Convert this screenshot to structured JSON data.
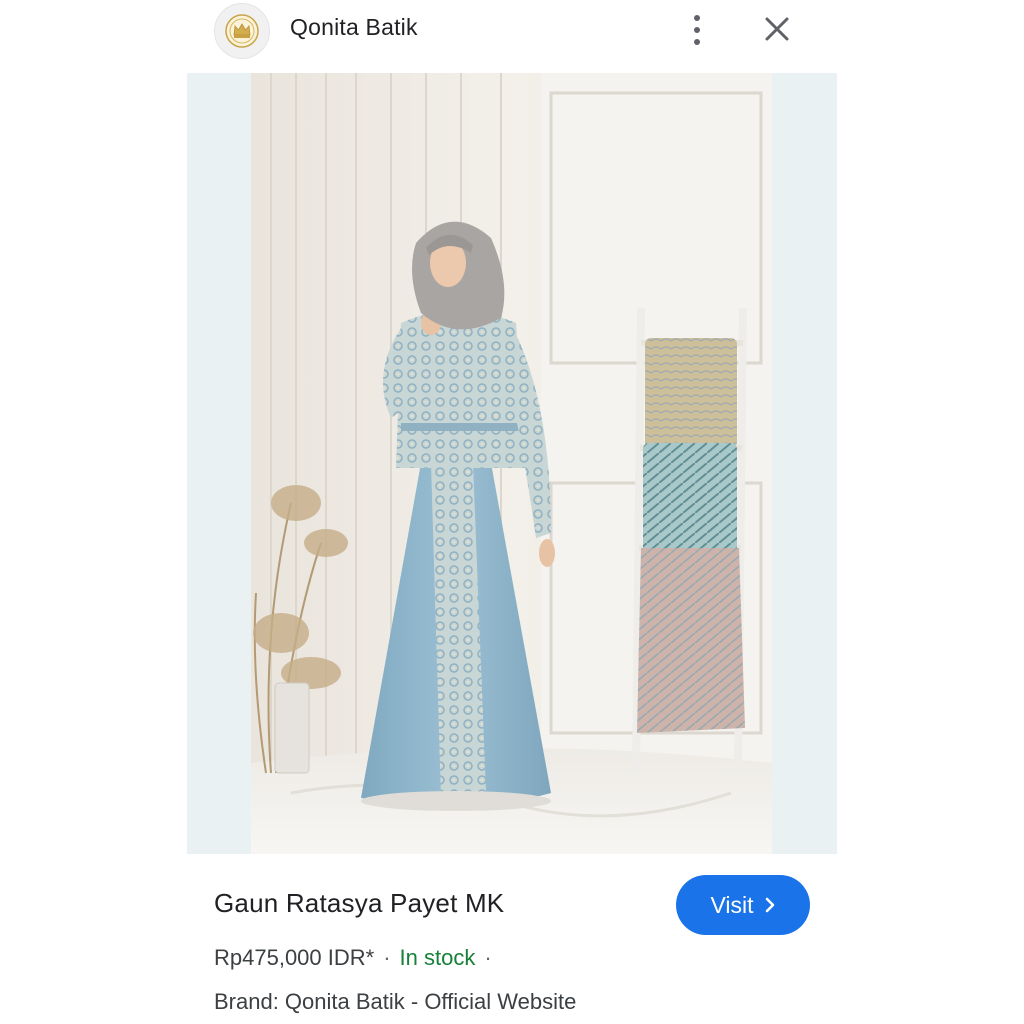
{
  "header": {
    "site_name": "Qonita Batik",
    "logo_icon": "crown-emblem-icon",
    "more_icon": "more-vertical-icon",
    "close_icon": "close-icon"
  },
  "image": {
    "subject": "product-photo"
  },
  "product": {
    "title": "Gaun Ratasya Payet MK",
    "price": "Rp475,000 IDR*",
    "separator": "·",
    "stock_status": "In stock",
    "brand_line": "Brand: Qonita Batik - Official Website"
  },
  "actions": {
    "visit_label": "Visit",
    "visit_icon": "chevron-right-icon"
  },
  "colors": {
    "accent": "#1a73e8",
    "in_stock": "#188038",
    "image_bg": "#eaf1f2"
  }
}
